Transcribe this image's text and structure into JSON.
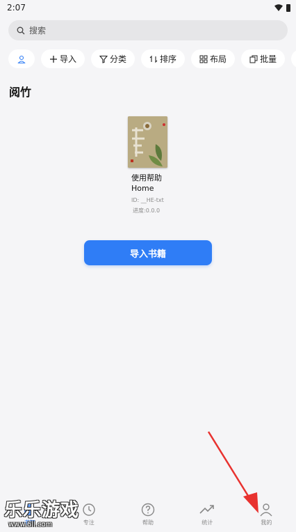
{
  "status_bar": {
    "time": "2:07"
  },
  "search": {
    "placeholder": "搜索"
  },
  "chips": [
    {
      "label": "导入"
    },
    {
      "label": "分类"
    },
    {
      "label": "排序"
    },
    {
      "label": "布局"
    },
    {
      "label": "批量"
    }
  ],
  "section": {
    "title": "阅竹"
  },
  "book": {
    "title_line1": "使用帮助",
    "title_line2": "Home",
    "id": "ID: __HE-txt",
    "progress": "进度:0.0.0"
  },
  "import_button": {
    "label": "导入书籍"
  },
  "bottom_nav": [
    {
      "label": "书架",
      "icon": "bookshelf-icon"
    },
    {
      "label": "专注",
      "icon": "clock-icon"
    },
    {
      "label": "帮助",
      "icon": "help-circle-icon"
    },
    {
      "label": "统计",
      "icon": "trending-icon"
    },
    {
      "label": "我的",
      "icon": "person-icon"
    }
  ],
  "watermark": {
    "text": "乐乐游戏",
    "url": "www.6ll.com"
  },
  "colors": {
    "accent": "#2f7df6",
    "annotation_arrow": "#e8322f",
    "background": "#f5f5f7"
  }
}
